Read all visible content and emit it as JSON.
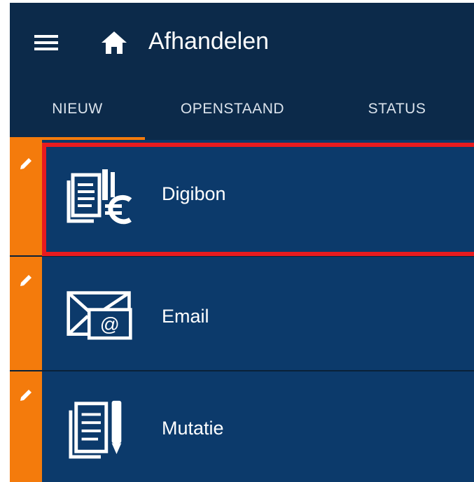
{
  "header": {
    "title": "Afhandelen",
    "menu_icon": "hamburger-menu-icon",
    "home_icon": "home-icon"
  },
  "tabs": [
    {
      "label": "NIEUW",
      "active": true
    },
    {
      "label": "OPENSTAAND",
      "active": false
    },
    {
      "label": "STATUS",
      "active": false
    }
  ],
  "items": [
    {
      "label": "Digibon",
      "icon": "receipt-euro-icon",
      "edit_icon": "pencil-icon",
      "highlighted": true
    },
    {
      "label": "Email",
      "icon": "envelope-at-icon",
      "edit_icon": "pencil-icon",
      "highlighted": false
    },
    {
      "label": "Mutatie",
      "icon": "document-pencil-icon",
      "edit_icon": "pencil-icon",
      "highlighted": false
    }
  ],
  "colors": {
    "appbar": "#0c2a4a",
    "item_background": "#0c3a6b",
    "accent": "#f47b0c",
    "highlight": "#e81b1f"
  }
}
